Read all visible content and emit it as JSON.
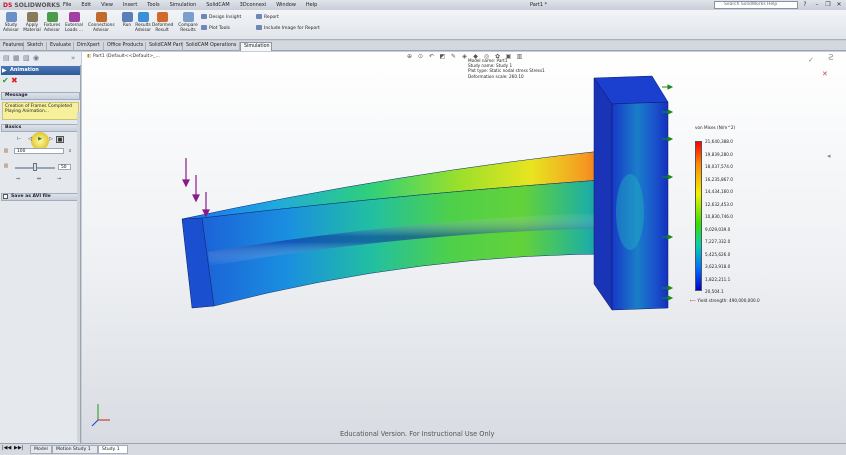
{
  "app": {
    "logo_brand": "DS",
    "logo_name": "SOLIDWORKS",
    "document_title": "Part1 *",
    "search_placeholder": "Search SolidWorks Help"
  },
  "menu": [
    "File",
    "Edit",
    "View",
    "Insert",
    "Tools",
    "Simulation",
    "SolidCAM",
    "3Dconnexi",
    "Window",
    "Help"
  ],
  "command_manager": {
    "large": [
      {
        "label": "Study\nAdvisor",
        "color": "#6b8fc7"
      },
      {
        "label": "Apply\nMaterial",
        "color": "#8a7a5c"
      },
      {
        "label": "Fixtures\nAdvisor",
        "color": "#4a9c4a"
      },
      {
        "label": "External\nLoads ...",
        "color": "#a23fa0"
      },
      {
        "label": "Connections\nAdvisor",
        "color": "#c06a2d"
      },
      {
        "label": "Run",
        "color": "#5a7fb8"
      },
      {
        "label": "Results\nAdvisor",
        "color": "#3d8fd6"
      },
      {
        "label": "Deformed\nResult",
        "color": "#d26a2d"
      },
      {
        "label": "Compare\nResults",
        "color": "#7a9fcf"
      }
    ],
    "small": [
      "Design Insight",
      "Plot Tools",
      "Report",
      "Include Image for Report"
    ]
  },
  "tabs": [
    "Features",
    "Sketch",
    "Evaluate",
    "DimXpert",
    "Office Products",
    "SolidCAM Part",
    "SolidCAM Operations",
    "Simulation"
  ],
  "active_tab": "Simulation",
  "left_panel": {
    "title": "Animation",
    "ok": "✔",
    "cancel": "✖",
    "message_header": "Message",
    "message_line1": "Creation of Frames Completed",
    "message_line2": "Playing Animation...",
    "basics_header": "Basics",
    "frames_value": "100",
    "speed_value": "50",
    "save_avi_header": "Save as AVI file"
  },
  "viewport": {
    "feature_tree": "Part1 (Default<<Default>_...",
    "plot_info": {
      "model_name": "Model name: Part1",
      "study_name": "Study name: Study 1",
      "plot_type": "Plot type: Static nodal stress Stress1",
      "deformation": "Deformation scale: 260.10"
    },
    "legend": {
      "title": "von Mises (N/m^2)",
      "values": [
        "21,640,388.0",
        "19,839,280.0",
        "18,037,574.0",
        "16,235,867.0",
        "14,434,160.0",
        "12,632,453.0",
        "10,830,746.0",
        "9,029,039.0",
        "7,227,332.0",
        "5,425,626.0",
        "3,623,918.0",
        "1,822,211.1",
        "20,504.1"
      ],
      "yield": "Yield strength: 490,000,000.0"
    },
    "watermark": "Educational Version. For Instructional Use Only"
  },
  "bottom_tabs": [
    "Model",
    "Motion Study 1",
    "Study 1"
  ],
  "active_bottom_tab": "Study 1"
}
